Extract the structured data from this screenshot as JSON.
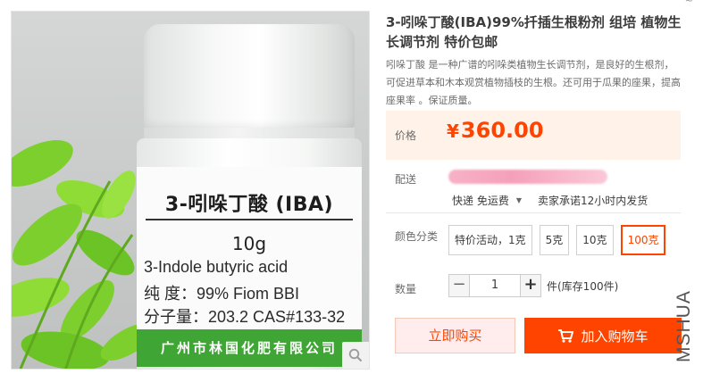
{
  "product_image": {
    "label_title": "3-吲哚丁酸 (IBA)",
    "label_amount": "10g",
    "label_name_en": "3-Indole butyric acid",
    "label_purity": "纯  度：99%  Fiom BBI",
    "label_mw": "分子量：203.2  CAS#133-32",
    "label_company": "广州市林国化肥有限公司",
    "zoom_icon": "magnifier-icon"
  },
  "top_mark": "~",
  "title": "3-吲哚丁酸(IBA)99%扦插生根粉剂 组培 植物生长调节剂 特价包邮",
  "subtitle": "吲哚丁酸 是一种广谱的吲哚类植物生长调节剂，是良好的生根剂，可促进草本和木本观赏植物插枝的生根。还可用于瓜果的座果，提高座果率 。保证质量。",
  "price": {
    "label": "价格",
    "currency": "¥",
    "value": "360.00"
  },
  "shipping": {
    "label": "配送",
    "method": "快递 免运费",
    "promise": "卖家承诺12小时内发货"
  },
  "options": {
    "label": "颜色分类",
    "items": [
      "特价活动，1克",
      "5克",
      "10克",
      "100克"
    ],
    "selected_index": 3
  },
  "quantity": {
    "label": "数量",
    "minus": "−",
    "value": "1",
    "plus": "+",
    "stock": "件(库存100件)"
  },
  "buttons": {
    "buy_now": "立即购买",
    "add_to_cart": "加入购物车"
  },
  "watermark": "MSHUA",
  "colors": {
    "accent": "#ff4400",
    "price_bg": "#fff2e8",
    "label_band": "#3fa535"
  }
}
